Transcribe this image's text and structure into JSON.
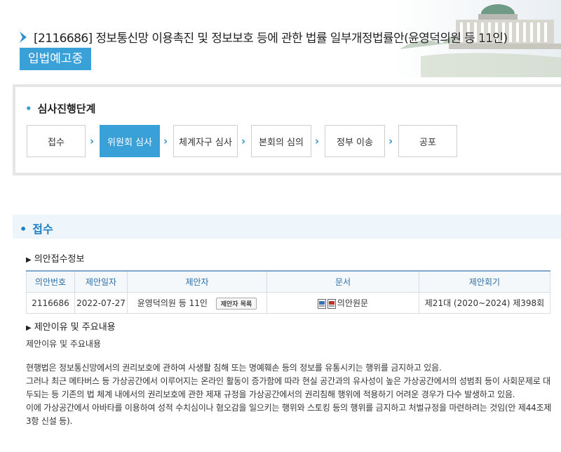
{
  "header": {
    "title": "[2116686] 정보통신망 이용촉진 및 정보보호 등에 관한 법률 일부개정법률안(윤영덕의원 등 11인)",
    "status": "입법예고중"
  },
  "stage": {
    "title": "심사진행단계",
    "steps": [
      "접수",
      "위원회 심사",
      "체계자구 심사",
      "본회의 심의",
      "정부 이송",
      "공포"
    ],
    "active_index": 1
  },
  "receipt": {
    "section_title": "접수",
    "info_heading": "의안접수정보",
    "columns": [
      "의안번호",
      "제안일자",
      "제안자",
      "문서",
      "제안회기"
    ],
    "row": {
      "bill_no": "2116686",
      "date": "2022-07-27",
      "proposer": "윤영덕의원 등 11인",
      "proposer_button": "제안자 목록",
      "document": "의안원문",
      "session": "제21대 (2020~2024) 제398회"
    },
    "reason_heading": "제안이유 및 주요내용",
    "reason_label": "제안이유 및 주요내용",
    "paragraphs": [
      "현행법은 정보통신망에서의 권리보호에 관하여 사생활 침해 또는 명예훼손 등의 정보를 유통시키는 행위를 금지하고 있음.",
      "그러나 최근 메타버스 등 가상공간에서 이루어지는 온라인 활동이 증가함에 따라 현실 공간과의 유사성이 높은 가상공간에서의 성범죄 등이 사회문제로 대두되는 등 기존의 법 체계 내에서의 권리보호에 관한 제재 규정을 가상공간에서의 권리침해 행위에 적용하기 어려운 경우가 다수 발생하고 있음.",
      "이에 가상공간에서 아바타를 이용하여 성적 수치심이나 혐오감을 일으키는 행위와 스토킹 등의 행위를 금지하고 처벌규정을 마련하려는 것임(안 제44조제3항 신설 등)."
    ]
  },
  "colors": {
    "accent": "#3aa0d8",
    "section_bg": "#eef5fb",
    "link_blue": "#1f7fc4"
  },
  "icons": [
    "chevron-right-icon",
    "hwp-file-icon",
    "pdf-file-icon",
    "national-assembly-building-image"
  ]
}
